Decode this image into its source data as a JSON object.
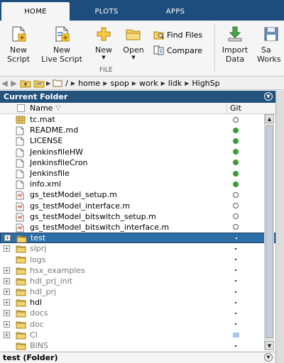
{
  "tabs": [
    {
      "label": "HOME",
      "active": true
    },
    {
      "label": "PLOTS",
      "active": false
    },
    {
      "label": "APPS",
      "active": false
    }
  ],
  "ribbon": {
    "new_script": {
      "line1": "New",
      "line2": "Script"
    },
    "new_live_script": {
      "line1": "New",
      "line2": "Live Script"
    },
    "new": {
      "label": "New"
    },
    "open": {
      "label": "Open"
    },
    "find_files": "Find Files",
    "compare": "Compare",
    "file_group_label": "FILE",
    "import_data": {
      "line1": "Import",
      "line2": "Data"
    },
    "save_workspace": {
      "line1": "Sa",
      "line2": "Works"
    }
  },
  "address_bar": {
    "root": "/",
    "segments": [
      "home",
      "spop",
      "work",
      "lldk",
      "HighSp"
    ]
  },
  "current_folder": {
    "title": "Current Folder",
    "columns": {
      "name": "Name",
      "sort_indicator": "▽",
      "git": "Git"
    },
    "rows": [
      {
        "name": "tc.mat",
        "icon": "mat-file-icon",
        "git": "clean",
        "expandable": false,
        "selected": false
      },
      {
        "name": "README.md",
        "icon": "text-file-icon",
        "git": "modified",
        "expandable": false,
        "selected": false
      },
      {
        "name": "LICENSE",
        "icon": "text-file-icon",
        "git": "modified",
        "expandable": false,
        "selected": false
      },
      {
        "name": "JenkinsfileHW",
        "icon": "text-file-icon",
        "git": "modified",
        "expandable": false,
        "selected": false
      },
      {
        "name": "JenkinsfileCron",
        "icon": "text-file-icon",
        "git": "modified",
        "expandable": false,
        "selected": false
      },
      {
        "name": "Jenkinsfile",
        "icon": "text-file-icon",
        "git": "modified",
        "expandable": false,
        "selected": false
      },
      {
        "name": "info.xml",
        "icon": "text-file-icon",
        "git": "modified",
        "expandable": false,
        "selected": false
      },
      {
        "name": "gs_testModel_setup.m",
        "icon": "m-script-icon",
        "git": "clean",
        "expandable": false,
        "selected": false
      },
      {
        "name": "gs_testModel_interface.m",
        "icon": "m-script-icon",
        "git": "clean",
        "expandable": false,
        "selected": false
      },
      {
        "name": "gs_testModel_bitswitch_setup.m",
        "icon": "m-script-icon",
        "git": "clean",
        "expandable": false,
        "selected": false
      },
      {
        "name": "gs_testModel_bitswitch_interface.m",
        "icon": "m-script-icon",
        "git": "clean",
        "expandable": false,
        "selected": false
      },
      {
        "name": "test",
        "icon": "folder-icon",
        "git": "dot",
        "expandable": true,
        "selected": true
      },
      {
        "name": "slprj",
        "icon": "folder-icon",
        "git": "dot",
        "expandable": true,
        "selected": false,
        "dim": true
      },
      {
        "name": "logs",
        "icon": "folder-icon",
        "git": "dot",
        "expandable": false,
        "selected": false,
        "dim": true
      },
      {
        "name": "hsx_examples",
        "icon": "folder-icon",
        "git": "dot",
        "expandable": true,
        "selected": false,
        "dim": true
      },
      {
        "name": "hdl_prj_init",
        "icon": "folder-icon",
        "git": "dot",
        "expandable": true,
        "selected": false,
        "dim": true
      },
      {
        "name": "hdl_prj",
        "icon": "folder-icon",
        "git": "dot",
        "expandable": true,
        "selected": false,
        "dim": true
      },
      {
        "name": "hdl",
        "icon": "folder-icon",
        "git": "dot",
        "expandable": true,
        "selected": false
      },
      {
        "name": "docs",
        "icon": "folder-icon",
        "git": "dot",
        "expandable": true,
        "selected": false,
        "dim": true
      },
      {
        "name": "doc",
        "icon": "folder-icon",
        "git": "dot",
        "expandable": true,
        "selected": false,
        "dim": true
      },
      {
        "name": "CI",
        "icon": "folder-icon",
        "git": "untracked",
        "expandable": true,
        "selected": false,
        "dim": true
      },
      {
        "name": "BINS",
        "icon": "folder-icon",
        "git": "dot",
        "expandable": false,
        "selected": false,
        "dim": true
      }
    ]
  },
  "details": {
    "label": "test  (Folder)"
  },
  "colors": {
    "tab_bar": "#1d4d7c",
    "panel_header": "#23527c",
    "selection": "#2e6ea7",
    "git_modified": "#3c9a3c",
    "folder": "#e8c35a"
  }
}
